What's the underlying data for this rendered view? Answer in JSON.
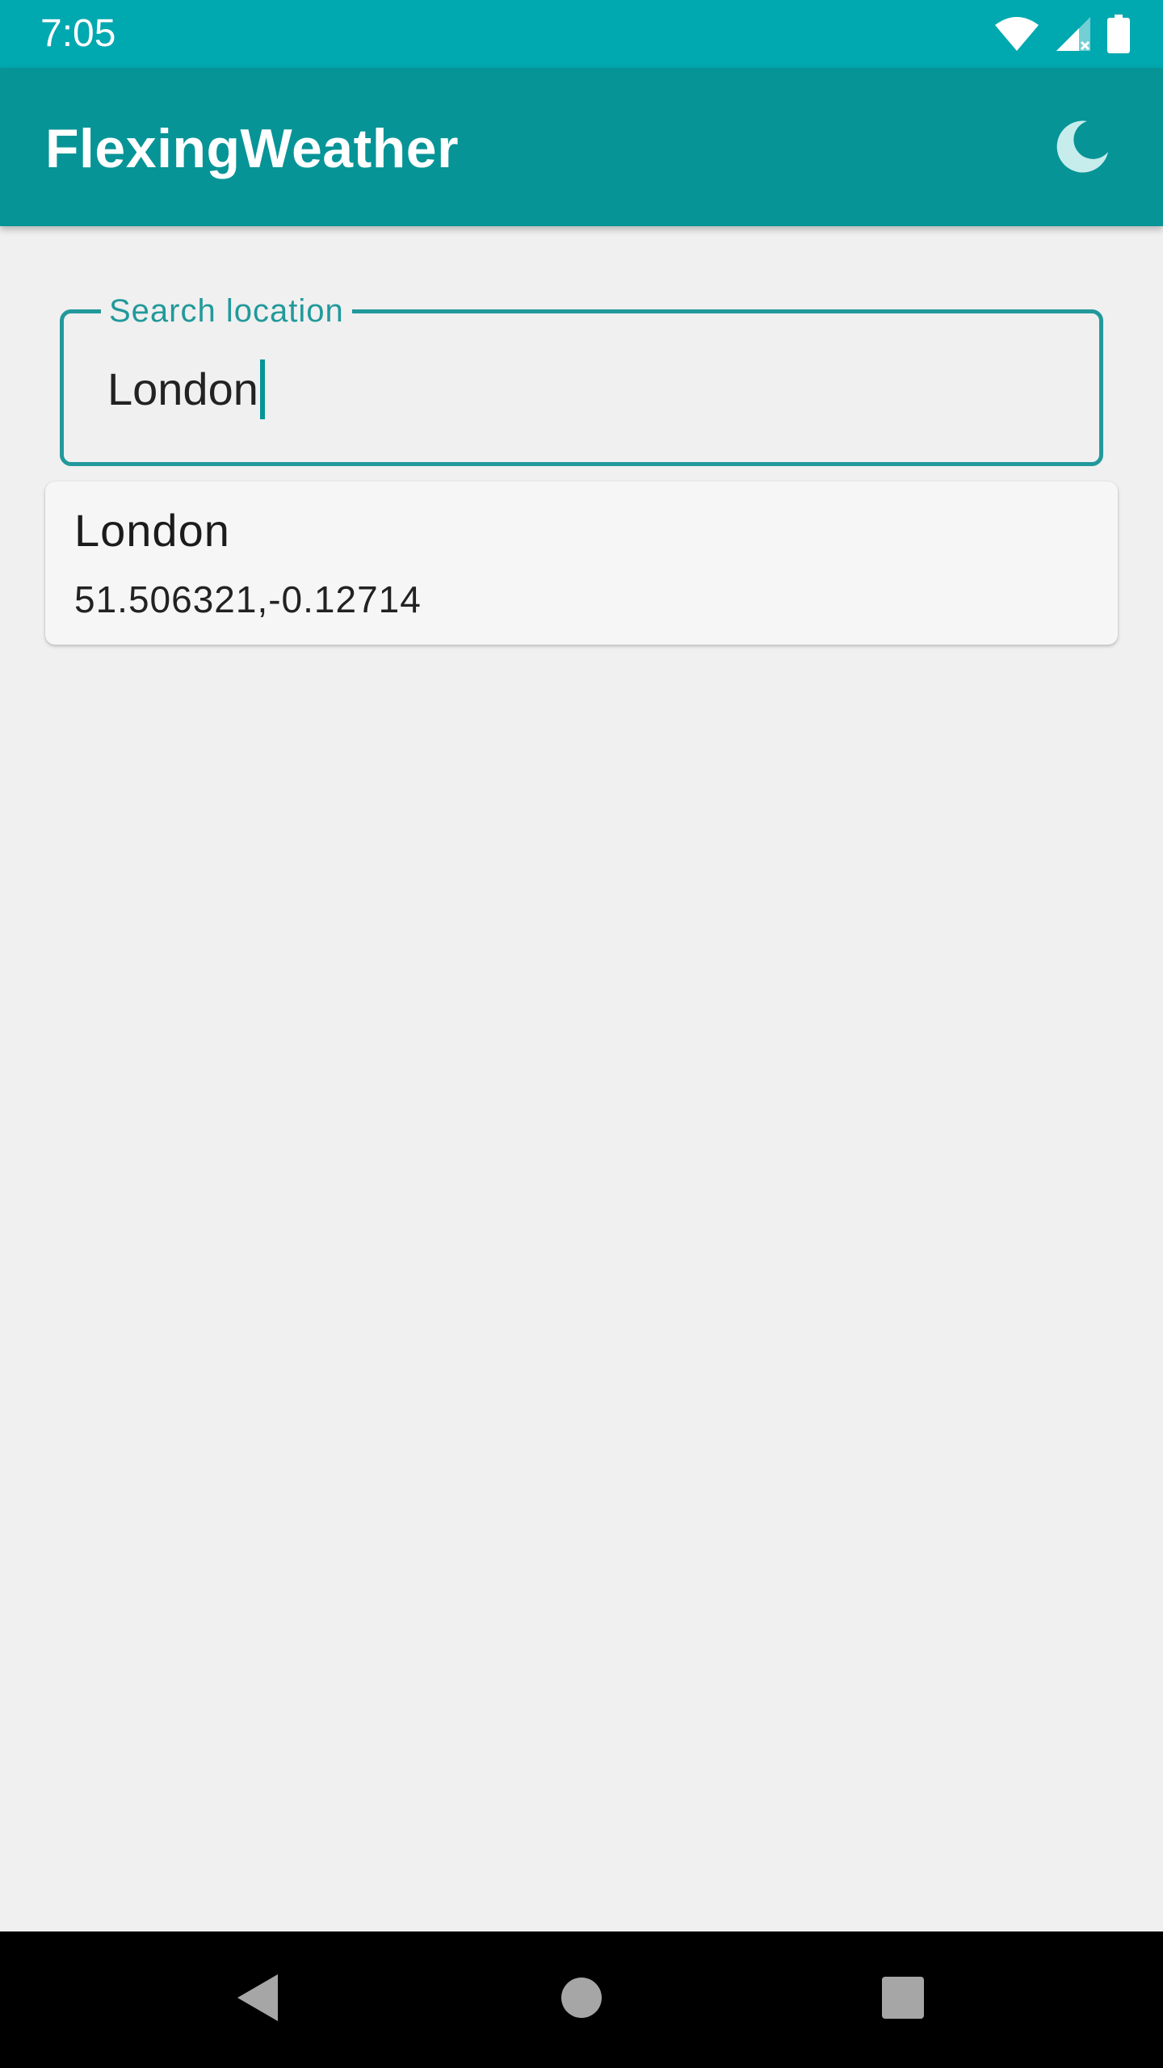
{
  "status_bar": {
    "time": "7:05",
    "icons": [
      "wifi-icon",
      "cell-signal-icon",
      "battery-icon"
    ]
  },
  "app_bar": {
    "title": "FlexingWeather",
    "theme_icon": "moon-icon"
  },
  "search": {
    "label": "Search location",
    "value": "London"
  },
  "results": [
    {
      "name": "London",
      "coordinates": "51.506321,-0.12714"
    }
  ],
  "nav_bar": {
    "icons": [
      "back-icon",
      "home-icon",
      "recents-icon"
    ]
  },
  "colors": {
    "status_bar": "#00a8b0",
    "app_bar": "#079497",
    "accent": "#22999b",
    "background": "#f0f0f0",
    "card": "#f6f6f6"
  }
}
